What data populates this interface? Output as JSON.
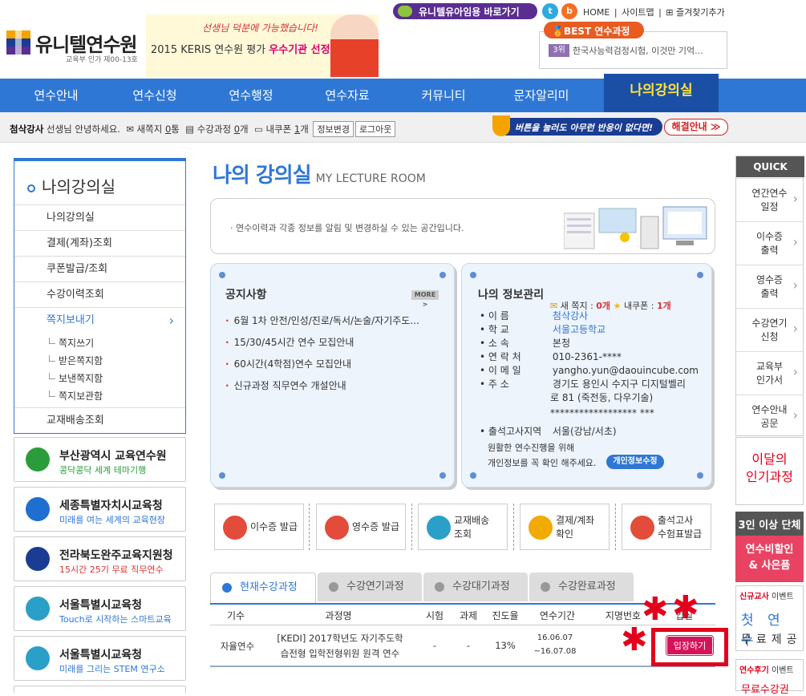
{
  "header": {
    "logo_text": "유니텔연수원",
    "logo_sub": "교육부 인가 제00-13호",
    "banner_script": "선생님 덕분에 가능했습니다!",
    "banner_prefix": "2015 KERIS 연수원 평가 ",
    "banner_highlight": "우수기관 선정",
    "top_pill": "유니텔유아임용 바로가기",
    "sns_twitter": "t",
    "sns_blog": "b",
    "links": [
      "HOME",
      "|",
      "사이트맵",
      "|",
      "⊞ 즐겨찾기추가"
    ],
    "best_label": "BEST 연수과정",
    "best_rank": "3위",
    "best_text": "한국사능력검정시험, 이것만 기억..."
  },
  "gnb": {
    "items": [
      "연수안내",
      "연수신청",
      "연수행정",
      "연수자료",
      "커뮤니티",
      "문자알리미"
    ],
    "my_room": "나의강의실"
  },
  "userbar": {
    "user_name": "첨삭강사",
    "greeting": " 선생님 안녕하세요.",
    "mail_label": "새쪽지",
    "mail_count": "0",
    "mail_unit": "통",
    "course_label": "수강과정",
    "course_count": "0",
    "course_unit": "개",
    "coupon_label": "내쿠폰",
    "coupon_count": "1",
    "coupon_unit": "개",
    "edit_btn": "정보변경",
    "logout_btn": "로그아웃",
    "warn_text": "버튼을 눌러도 아무런 반응이 없다면!",
    "solve_btn": "해결안내 ≫"
  },
  "lnb": {
    "title": "나의강의실",
    "items": [
      "나의강의실",
      "결제(계좌)조회",
      "쿠폰발급/조회",
      "수강이력조회",
      "쪽지보내기"
    ],
    "active_arrow": "›",
    "subitems": [
      "쪽지쓰기",
      "받은쪽지함",
      "보낸쪽지함",
      "쪽지보관함"
    ],
    "last_item": "교재배송조회"
  },
  "orgs": [
    {
      "name": "부산광역시 교육연수원",
      "sub": "콩닥콩닥 세계 테마기행",
      "color": "#2a9d3a"
    },
    {
      "name": "세종특별자치시교육청",
      "sub": "미래를 여는 세계의 교육현장",
      "color": "#1f6fd1"
    },
    {
      "name": "전라북도완주교육지원청",
      "sub": "15시간 25기 무료 직무연수",
      "color": "#1a3d93"
    },
    {
      "name": "서울특별시교육청",
      "sub": "Touch로 시작하는 스마트교육",
      "color": "#2aa0c8"
    },
    {
      "name": "서울특별시교육청",
      "sub": "미래를 그리는 STEM 연구소",
      "color": "#2aa0c8"
    }
  ],
  "page": {
    "title": "나의 강의실",
    "subtitle": "MY LECTURE ROOM",
    "intro": "· 연수이력과 각종 정보를 알림 및 변경하실 수 있는 공간입니다."
  },
  "notice": {
    "title": "공지사항",
    "more": "MORE >",
    "items": [
      "6월 1차 안전/인성/진로/독서/논술/자기주도...",
      "15/30/45시간 연수 모집안내",
      "60시간(4학점)연수 모집안내",
      "신규과정 직무연수 개설안내"
    ]
  },
  "info": {
    "title": "나의 정보관리",
    "mail_label": "새 쪽지 : ",
    "mail_count": "0개",
    "coupon_label": "내쿠폰 : ",
    "coupon_count": "1개",
    "rows": [
      {
        "k": "이 름",
        "v": "첨삭강사"
      },
      {
        "k": "학 교",
        "v": "서울고등학교"
      },
      {
        "k": "소 속",
        "v": "본청"
      },
      {
        "k": "연 락 처",
        "v": "010-2361-****"
      },
      {
        "k": "이 메 일",
        "v": "yangho.yun@daouincube.com"
      },
      {
        "k": "주 소",
        "v": "경기도 용인시 수지구 디지털벨리"
      }
    ],
    "addr2": "로 81 (죽전동, 다우기술)",
    "addr3": "****************** ***",
    "exam_k": "출석고사지역",
    "exam_v": "서울(강남/서초)",
    "note1": "원활한 연수진행을 위해",
    "note2": "개인정보를 꼭 확인 해주세요.",
    "btn": "개인정보수정"
  },
  "quick_buttons": [
    {
      "label": "이수증 발급",
      "color": "#e34b3b"
    },
    {
      "label": "영수증 발급",
      "color": "#e34b3b"
    },
    {
      "label": "교재배송\n조회",
      "color": "#2aa0c8"
    },
    {
      "label": "결제/계좌\n확인",
      "color": "#f2a900"
    },
    {
      "label": "출석고사\n수험표발급",
      "color": "#e34b3b"
    }
  ],
  "tabs": [
    "현재수강과정",
    "수강연기과정",
    "수강대기과정",
    "수강완료과정"
  ],
  "table": {
    "headers": [
      "기수",
      "과정명",
      "시험",
      "과제",
      "진도율",
      "연수기간",
      "지명번호",
      "입실"
    ],
    "row": {
      "term": "자율연수",
      "course1": "[KEDI] 2017학년도 자기주도학",
      "course2": "습전형 입학전형위원 원격 연수",
      "exam": "-",
      "task": "-",
      "progress": "13%",
      "period1": "16.06.07",
      "period2": "~16.07.08",
      "enter_btn": "입장하기"
    }
  },
  "quick_menu": {
    "title": "QUICK MENU",
    "items": [
      "연간연수\n일정",
      "이수증\n출력",
      "영수증\n출력",
      "수강연기\n신청",
      "교육부\n인가서",
      "연수안내\n공문"
    ],
    "hot": "이달의\n인기과정",
    "group_title": "3인 이상 단체",
    "group_body": "연수비할인\n& 사은품",
    "new_h1": "신규교사",
    "new_h2": " 이벤트",
    "new_line1": "첫 연 수",
    "new_line2": "무료제공",
    "review_h1": "연수후기",
    "review_h2": " 이벤트",
    "review_text": "무료수강권"
  },
  "colors": {
    "primary": "#2f77d5",
    "gnb_active": "#1b4fa5",
    "accent": "#e3001b",
    "enter": "#d4145a"
  }
}
